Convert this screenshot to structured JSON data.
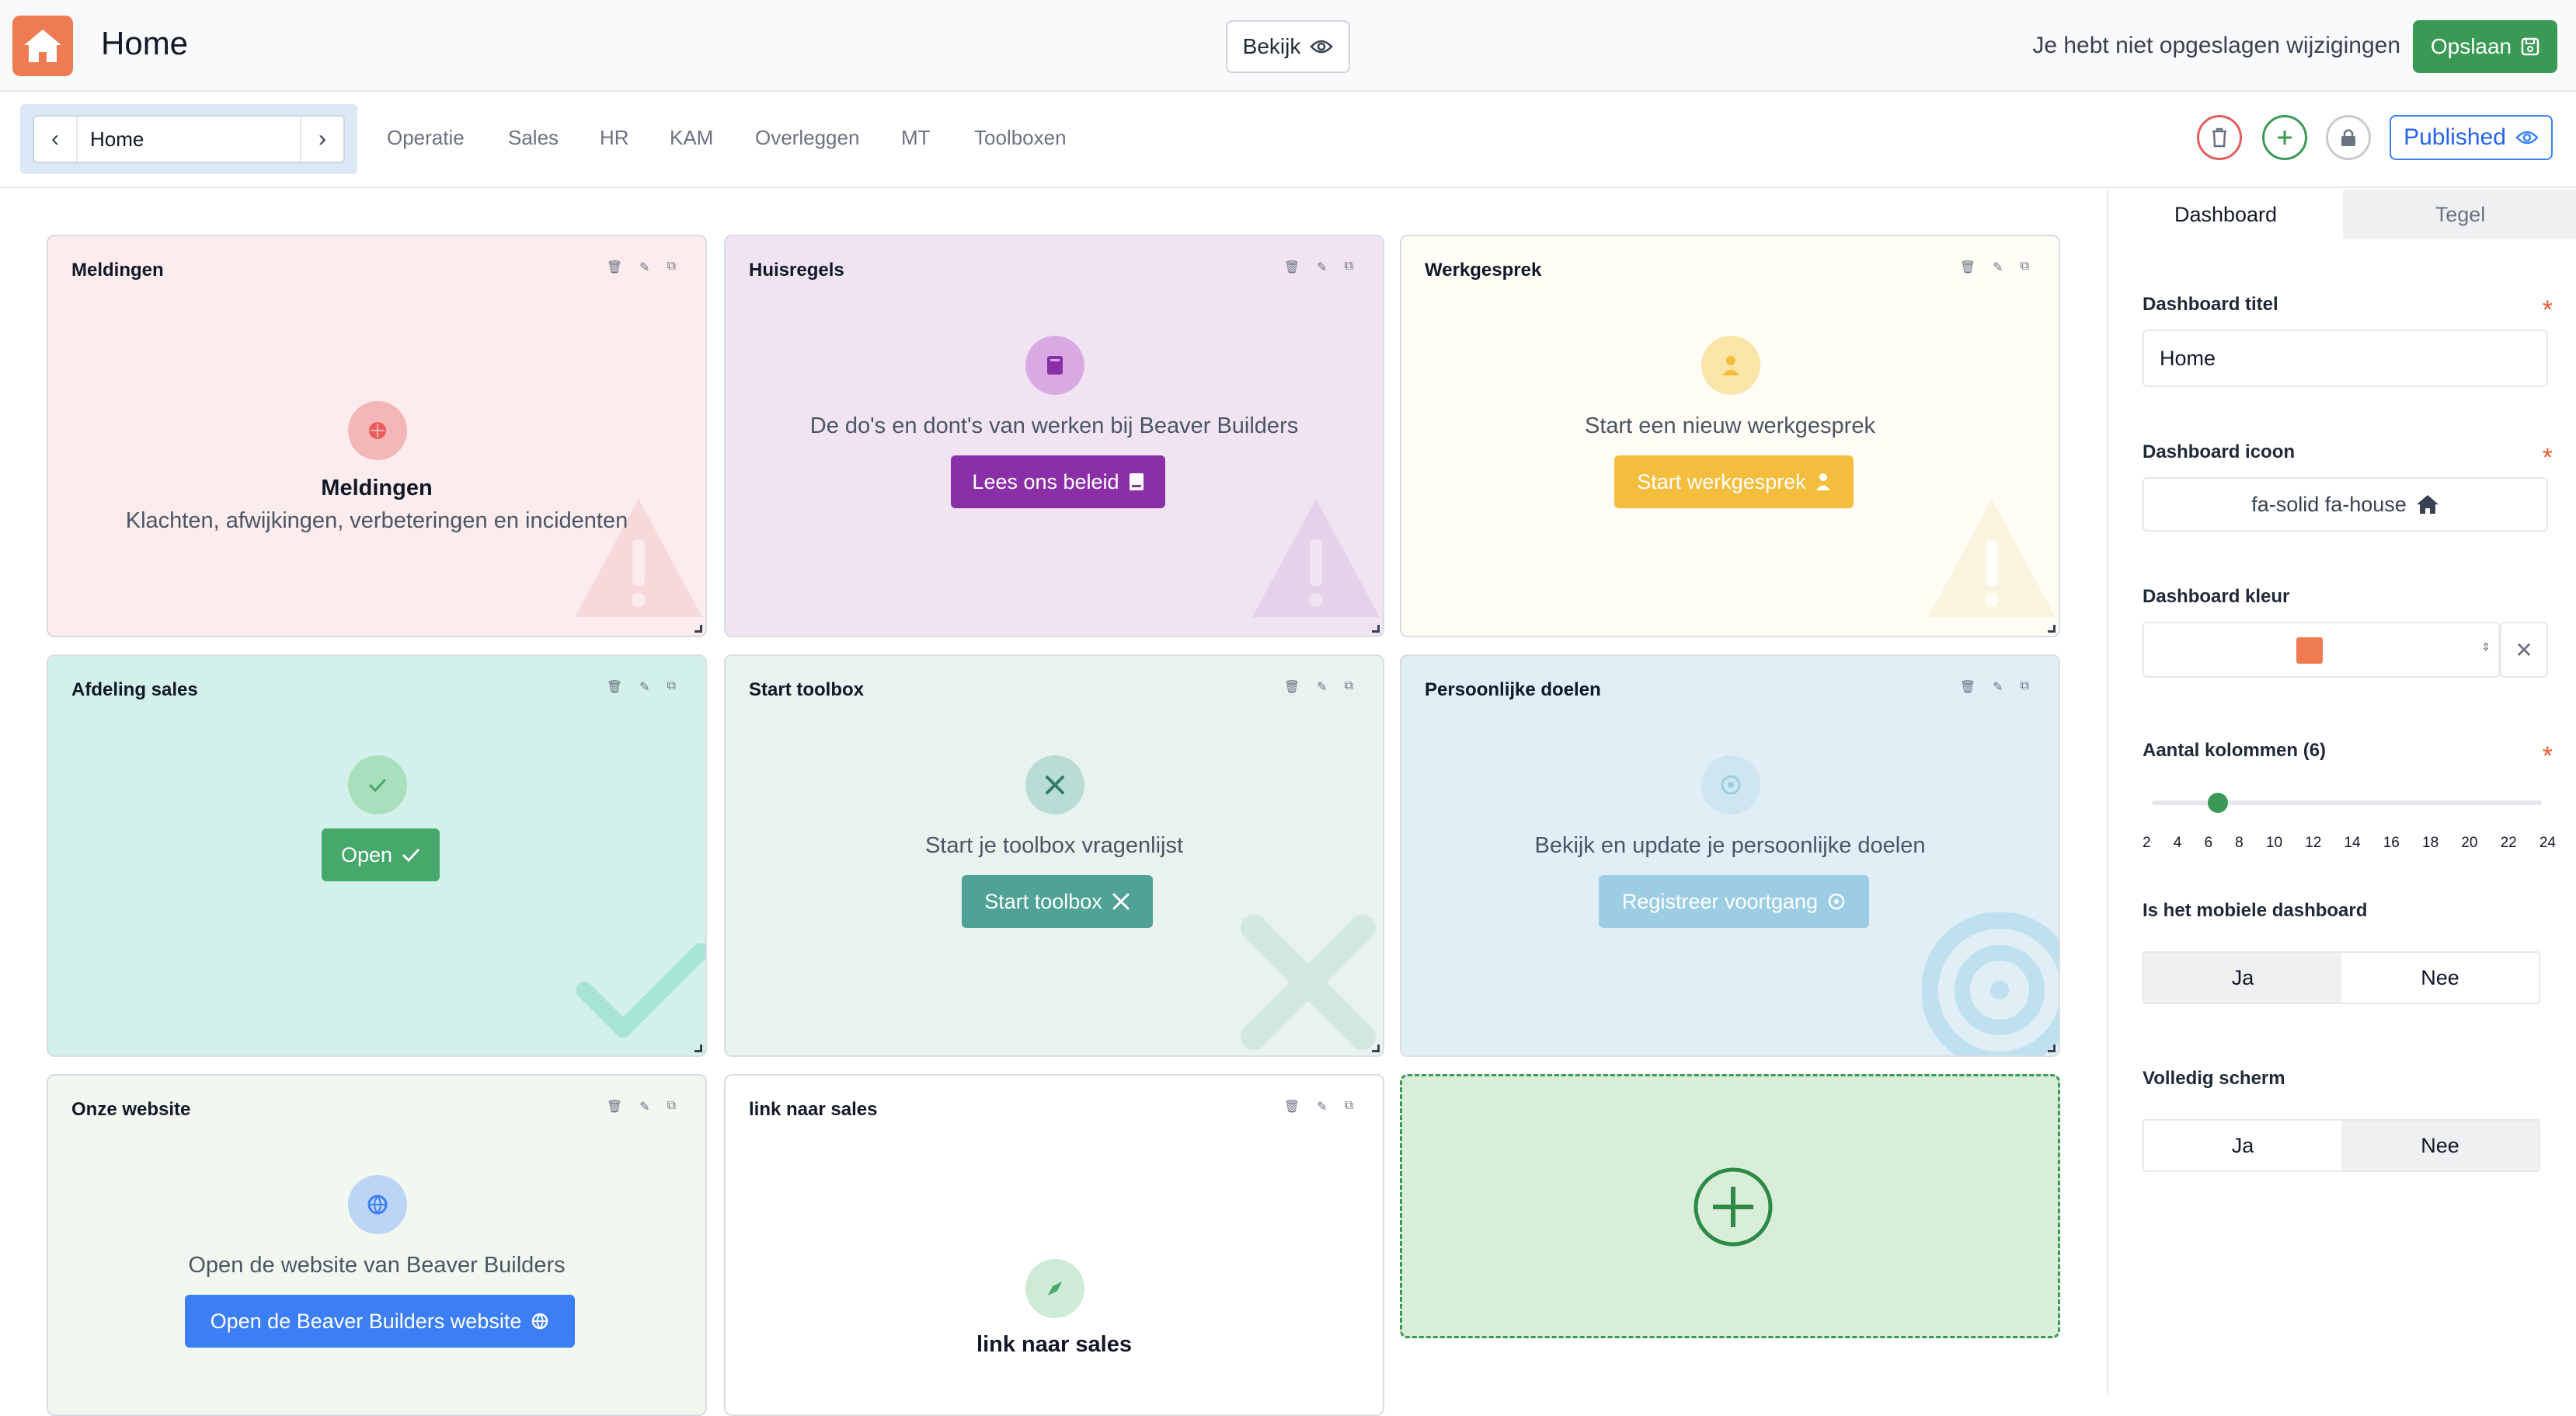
{
  "header": {
    "title": "Home",
    "view_label": "Bekijk",
    "unsaved_text": "Je hebt niet opgeslagen wijzigingen",
    "save_label": "Opslaan"
  },
  "nav": {
    "current_dashboard": "Home",
    "tabs": [
      "Operatie",
      "Sales",
      "HR",
      "KAM",
      "Overleggen",
      "MT",
      "Toolboxen"
    ],
    "published_label": "Published"
  },
  "tiles": [
    {
      "title": "Meldingen",
      "heading": "Meldingen",
      "text": "Klachten, afwijkingen, verbeteringen en incidenten"
    },
    {
      "title": "Huisregels",
      "text": "De do's en dont's van werken bij Beaver Builders",
      "button": "Lees ons beleid"
    },
    {
      "title": "Werkgesprek",
      "text": "Start een nieuw werkgesprek",
      "button": "Start werkgesprek"
    },
    {
      "title": "Afdeling sales",
      "button": "Open"
    },
    {
      "title": "Start toolbox",
      "text": "Start je toolbox vragenlijst",
      "button": "Start toolbox"
    },
    {
      "title": "Persoonlijke doelen",
      "text": "Bekijk en update je persoonlijke doelen",
      "button": "Registreer voortgang"
    },
    {
      "title": "Onze website",
      "text": "Open de website van Beaver Builders",
      "button": "Open de Beaver Builders website"
    },
    {
      "title": "link naar sales",
      "heading": "link naar sales"
    }
  ],
  "sidebar": {
    "tabs": [
      "Dashboard",
      "Tegel"
    ],
    "title_label": "Dashboard titel",
    "title_value": "Home",
    "icon_label": "Dashboard icoon",
    "icon_value": "fa-solid fa-house",
    "color_label": "Dashboard kleur",
    "color_value": "#ef7b53",
    "columns_label": "Aantal kolommen (6)",
    "columns_value": 6,
    "column_ticks": [
      "2",
      "4",
      "6",
      "8",
      "10",
      "12",
      "14",
      "16",
      "18",
      "20",
      "22",
      "24"
    ],
    "mobile_label": "Is het mobiele dashboard",
    "mobile_options": [
      "Ja",
      "Nee"
    ],
    "fullscreen_label": "Volledig scherm",
    "fullscreen_options": [
      "Ja",
      "Nee"
    ],
    "required_mark": "*"
  },
  "colors": {
    "brand": "#ef7b53",
    "save_green": "#3a9a55",
    "purple": "#8b2fa8",
    "yellow": "#f4bd3e",
    "green": "#46a86a",
    "teal": "#4fa295",
    "light_blue": "#9dcde3",
    "blue": "#3b7ef6"
  }
}
